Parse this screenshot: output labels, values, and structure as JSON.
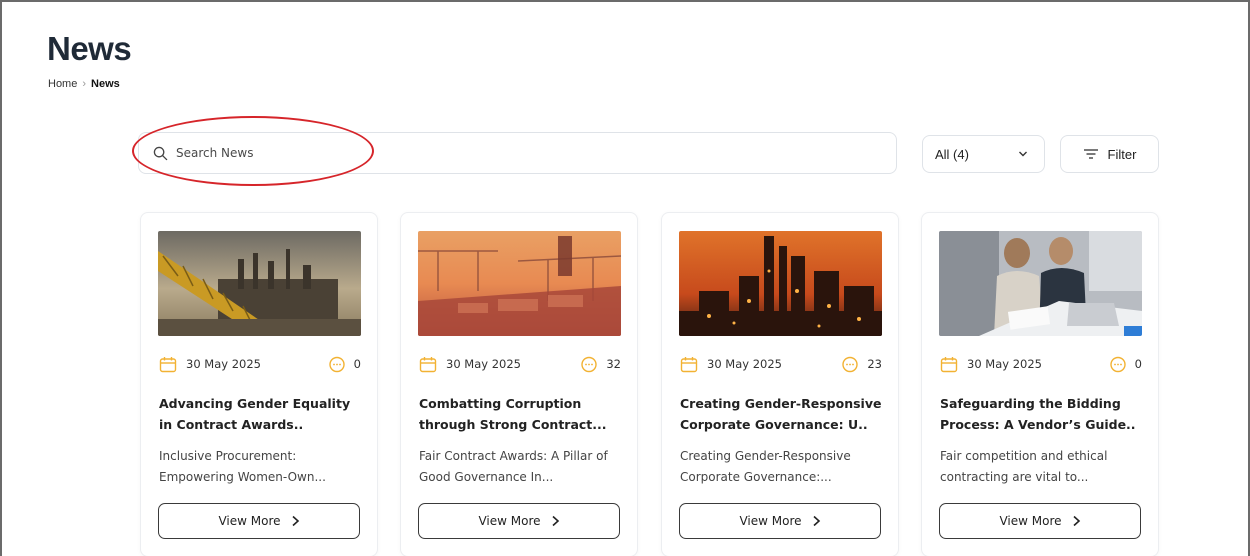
{
  "page": {
    "title": "News",
    "breadcrumb": {
      "home": "Home",
      "current": "News"
    }
  },
  "search": {
    "placeholder": "Search News",
    "value": ""
  },
  "toolbar": {
    "select_value": "All (4)",
    "filter_label": "Filter"
  },
  "colors": {
    "accent_icon": "#f2b233",
    "annotation": "#d6252a",
    "border": "#dfe3e8"
  },
  "icons": {
    "search": "search-icon",
    "dropdown": "chevron-down-icon",
    "filter": "filter-icon",
    "date": "calendar-icon",
    "comments": "comment-icon",
    "more": "chevron-right-icon"
  },
  "cards": [
    {
      "image": "offshore-oil-platform",
      "date": "30 May 2025",
      "comments": "0",
      "title": "Advancing Gender Equality in Contract Awards..",
      "excerpt": "Inclusive Procurement: Empowering Women-Own...",
      "button": "View More"
    },
    {
      "image": "port-cranes-sunset",
      "date": "30 May 2025",
      "comments": "32",
      "title": "Combatting Corruption through Strong Contract...",
      "excerpt": "Fair Contract Awards: A Pillar of Good Governance In...",
      "button": "View More"
    },
    {
      "image": "refinery-at-night",
      "date": "30 May 2025",
      "comments": "23",
      "title": "Creating Gender-Responsive Corporate Governance: U..",
      "excerpt": "Creating Gender-Responsive Corporate Governance:...",
      "button": "View More"
    },
    {
      "image": "business-meeting",
      "date": "30 May 2025",
      "comments": "0",
      "title": "Safeguarding the Bidding Process: A Vendor’s Guide..",
      "excerpt": "Fair competition and ethical contracting are vital to...",
      "button": "View More"
    }
  ]
}
